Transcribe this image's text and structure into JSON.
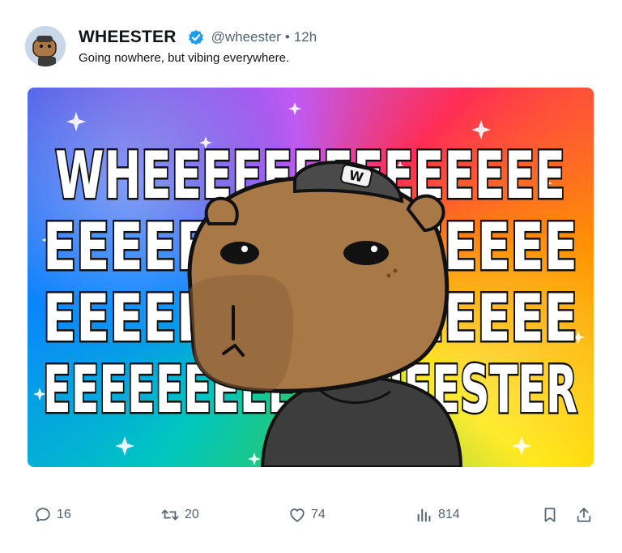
{
  "post": {
    "display_name": "WHEESTER",
    "handle": "@wheester",
    "separator": "•",
    "time": "12h",
    "text": "Going nowhere, but vibing everywhere.",
    "verified_color": "#1d9bf0"
  },
  "meme": {
    "lines": [
      "WHEEEEEEEEEEEEEE",
      "EEEEEEEEEEEEEEEE",
      "EEEEEEEEEEEEEEEE",
      "EEEEEEEEEEWHEESTER"
    ],
    "cap_logo": "W"
  },
  "metrics": {
    "replies": "16",
    "reposts": "20",
    "likes": "74",
    "views": "814"
  },
  "icons": [
    "reply-icon",
    "repost-icon",
    "like-icon",
    "views-icon",
    "bookmark-icon",
    "share-icon",
    "verified-badge-icon"
  ]
}
